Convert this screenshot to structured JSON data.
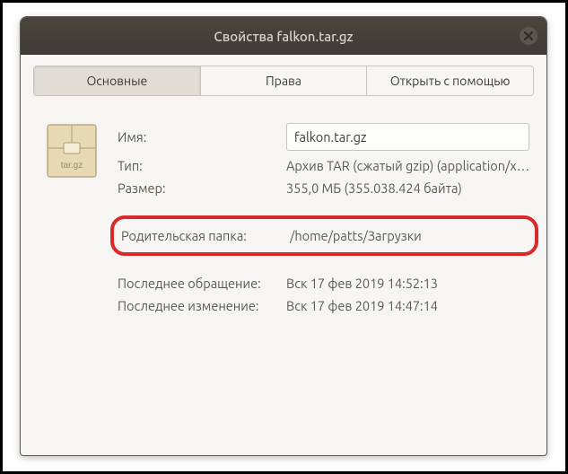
{
  "title": "Свойства falkon.tar.gz",
  "tabs": {
    "basic": "Основные",
    "permissions": "Права",
    "openwith": "Открыть с помощью"
  },
  "fields": {
    "name_label": "Имя:",
    "name_value": "falkon.tar.gz",
    "type_label": "Тип:",
    "type_value": "Архив TAR (сжатый gzip) (application/x…",
    "size_label": "Размер:",
    "size_value": "355,0 МБ (355.038.424 байта)",
    "parent_label": "Родительская папка:",
    "parent_value": "/home/patts/Загрузки",
    "accessed_label": "Последнее обращение:",
    "accessed_value": "Вск 17 фев 2019 14:52:13",
    "modified_label": "Последнее изменение:",
    "modified_value": "Вск 17 фев 2019 14:47:14"
  },
  "file_icon_tag": "tar.gz"
}
